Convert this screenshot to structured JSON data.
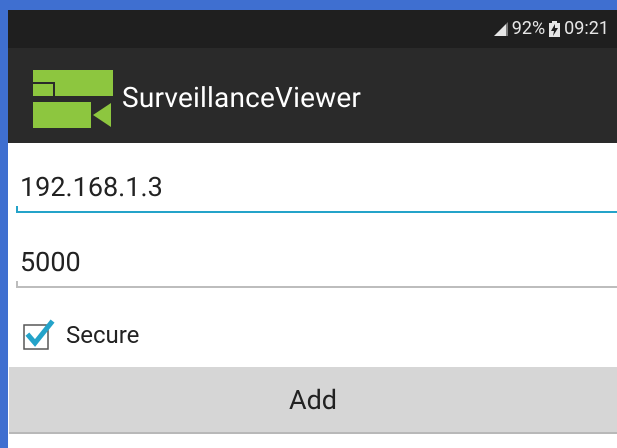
{
  "status_bar": {
    "battery_percent": "92%",
    "time": "09:21"
  },
  "action_bar": {
    "title": "SurveillanceViewer"
  },
  "form": {
    "host_value": "192.168.1.3",
    "port_value": "5000",
    "secure_label": "Secure",
    "secure_checked": true,
    "add_label": "Add"
  },
  "colors": {
    "accent": "#24a3c9",
    "logo": "#8dc63f",
    "action_bar": "#2a2a2a",
    "status_bar": "#1f1f1f",
    "button": "#d6d6d6"
  }
}
